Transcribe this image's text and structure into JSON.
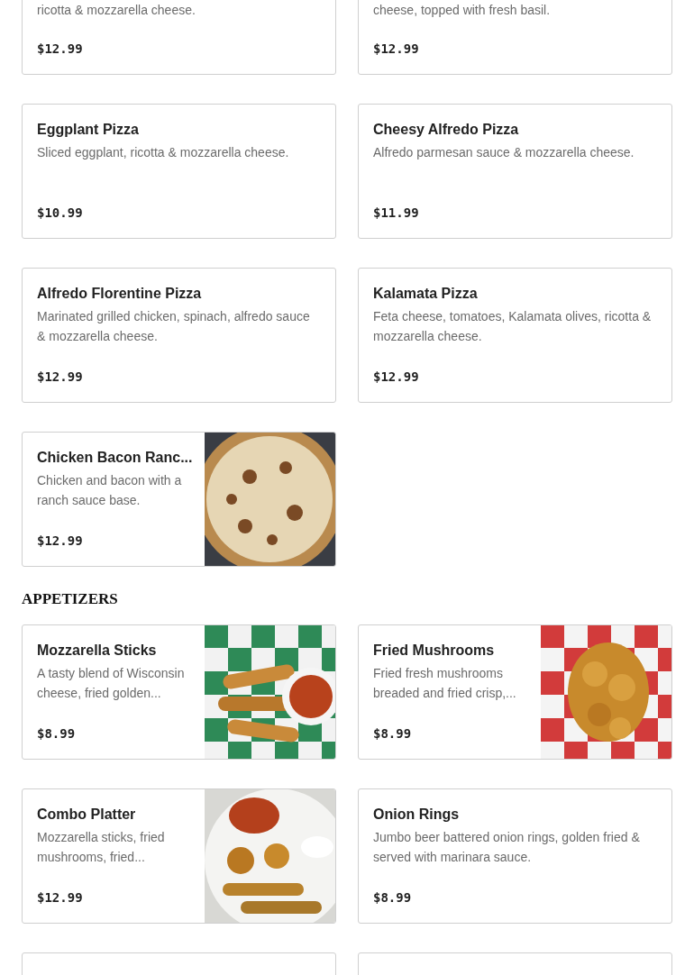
{
  "top_items": [
    {
      "description": "ricotta & mozzarella cheese.",
      "price": "$12.99"
    },
    {
      "description": "cheese, topped with fresh basil.",
      "price": "$12.99"
    }
  ],
  "pizza_items": [
    {
      "name": "Eggplant Pizza",
      "description": "Sliced eggplant, ricotta & mozzarella cheese.",
      "price": "$10.99"
    },
    {
      "name": "Cheesy Alfredo Pizza",
      "description": "Alfredo parmesan sauce & mozzarella cheese.",
      "price": "$11.99"
    },
    {
      "name": "Alfredo Florentine Pizza",
      "description": "Marinated grilled chicken, spinach, alfredo sauce & mozzarella cheese.",
      "price": "$12.99"
    },
    {
      "name": "Kalamata Pizza",
      "description": "Feta cheese, tomatoes, Kalamata olives, ricotta & mozzarella cheese.",
      "price": "$12.99"
    },
    {
      "name": "Chicken Bacon Ranc...",
      "description": "Chicken and bacon with a ranch sauce base.",
      "price": "$12.99"
    }
  ],
  "sections": [
    {
      "title": "APPETIZERS",
      "items": [
        {
          "name": "Mozzarella Sticks",
          "description": "A tasty blend of Wisconsin cheese, fried golden...",
          "price": "$8.99"
        },
        {
          "name": "Fried Mushrooms",
          "description": "Fried fresh mushrooms breaded and fried crisp,...",
          "price": "$8.99"
        },
        {
          "name": "Combo Platter",
          "description": "Mozzarella sticks, fried mushrooms, fried...",
          "price": "$12.99"
        },
        {
          "name": "Onion Rings",
          "description": "Jumbo beer battered onion rings, golden fried & served with marinara sauce.",
          "price": "$8.99"
        }
      ]
    }
  ]
}
